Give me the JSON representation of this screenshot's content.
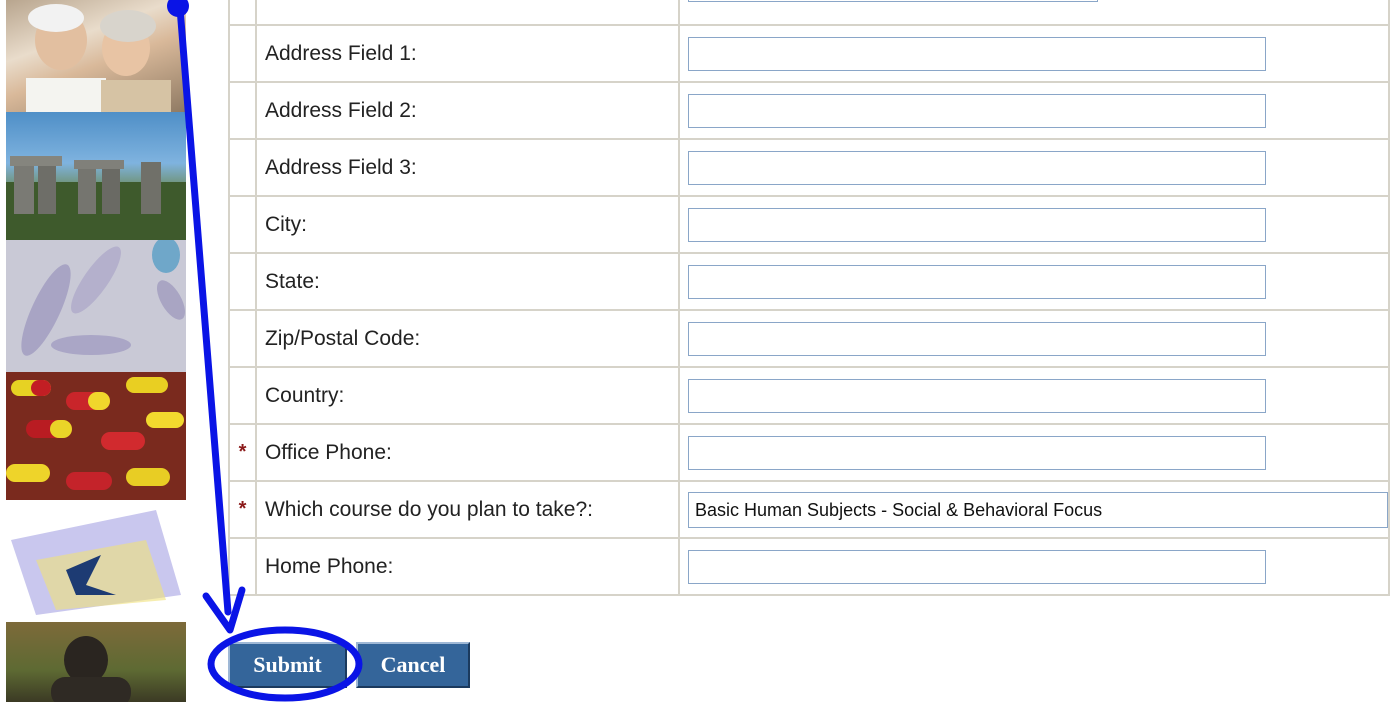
{
  "form": {
    "fields": [
      {
        "label": "Address Field 1:",
        "required": false,
        "value": ""
      },
      {
        "label": "Address Field 2:",
        "required": false,
        "value": ""
      },
      {
        "label": "Address Field 3:",
        "required": false,
        "value": ""
      },
      {
        "label": "City:",
        "required": false,
        "value": ""
      },
      {
        "label": "State:",
        "required": false,
        "value": ""
      },
      {
        "label": "Zip/Postal Code:",
        "required": false,
        "value": ""
      },
      {
        "label": "Country:",
        "required": false,
        "value": ""
      },
      {
        "label": "Office Phone:",
        "required": true,
        "value": ""
      },
      {
        "label": "Which course do you plan to take?:",
        "required": true,
        "selected": "Basic Human Subjects - Social & Behavioral Focus"
      },
      {
        "label": "Home Phone:",
        "required": false,
        "value": ""
      }
    ],
    "required_marker": "*"
  },
  "buttons": {
    "submit_label": "Submit",
    "cancel_label": "Cancel"
  },
  "annotation": {
    "color": "#0a14e6",
    "target": "submit-button"
  },
  "photos": [
    "elderly-couple-photo",
    "stonehenge-photo",
    "microorganism-photo",
    "capsules-photo",
    "butterfly-card-photo",
    "gorilla-photo"
  ]
}
